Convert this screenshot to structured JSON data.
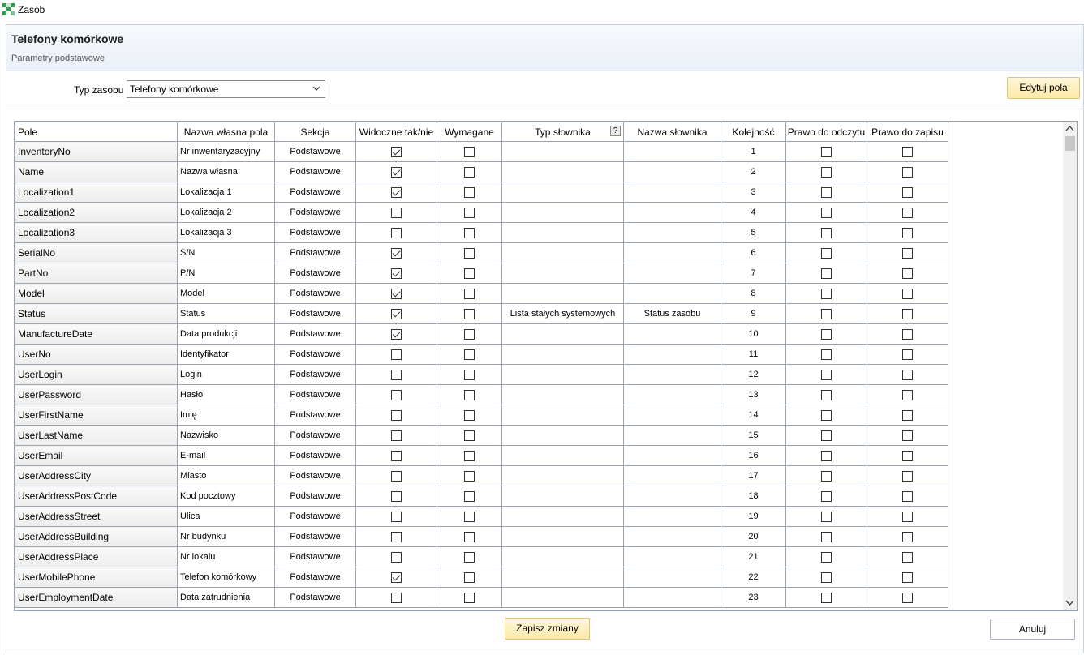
{
  "window": {
    "title": "Zasób",
    "logo_icon": "app-logo-icon"
  },
  "header": {
    "title": "Telefony komórkowe",
    "subtitle": "Parametry podstawowe"
  },
  "toolbar": {
    "type_label": "Typ zasobu",
    "type_value": "Telefony komórkowe",
    "edit_fields_label": "Edytuj pola"
  },
  "grid": {
    "columns": {
      "pole": "Pole",
      "name": "Nazwa własna pola",
      "section": "Sekcja",
      "visible": "Widoczne tak/nie",
      "required": "Wymagane",
      "dict_type": "Typ słownika",
      "dict_help": "?",
      "dict_name": "Nazwa słownika",
      "order": "Kolejność",
      "read": "Prawo do odczytu",
      "write": "Prawo do zapisu"
    },
    "rows": [
      {
        "field": "InventoryNo",
        "name": "Nr inwentaryzacyjny",
        "section": "Podstawowe",
        "visible": true,
        "required": false,
        "dict_type": "",
        "dict_name": "",
        "order": "1",
        "read": false,
        "write": false
      },
      {
        "field": "Name",
        "name": "Nazwa własna",
        "section": "Podstawowe",
        "visible": true,
        "required": false,
        "dict_type": "",
        "dict_name": "",
        "order": "2",
        "read": false,
        "write": false
      },
      {
        "field": "Localization1",
        "name": "Lokalizacja 1",
        "section": "Podstawowe",
        "visible": true,
        "required": false,
        "dict_type": "",
        "dict_name": "",
        "order": "3",
        "read": false,
        "write": false
      },
      {
        "field": "Localization2",
        "name": "Lokalizacja 2",
        "section": "Podstawowe",
        "visible": false,
        "required": false,
        "dict_type": "",
        "dict_name": "",
        "order": "4",
        "read": false,
        "write": false
      },
      {
        "field": "Localization3",
        "name": "Lokalizacja 3",
        "section": "Podstawowe",
        "visible": false,
        "required": false,
        "dict_type": "",
        "dict_name": "",
        "order": "5",
        "read": false,
        "write": false
      },
      {
        "field": "SerialNo",
        "name": "S/N",
        "section": "Podstawowe",
        "visible": true,
        "required": false,
        "dict_type": "",
        "dict_name": "",
        "order": "6",
        "read": false,
        "write": false
      },
      {
        "field": "PartNo",
        "name": "P/N",
        "section": "Podstawowe",
        "visible": true,
        "required": false,
        "dict_type": "",
        "dict_name": "",
        "order": "7",
        "read": false,
        "write": false
      },
      {
        "field": "Model",
        "name": "Model",
        "section": "Podstawowe",
        "visible": true,
        "required": false,
        "dict_type": "",
        "dict_name": "",
        "order": "8",
        "read": false,
        "write": false
      },
      {
        "field": "Status",
        "name": "Status",
        "section": "Podstawowe",
        "visible": true,
        "required": false,
        "dict_type": "Lista stałych systemowych",
        "dict_name": "Status zasobu",
        "order": "9",
        "read": false,
        "write": false
      },
      {
        "field": "ManufactureDate",
        "name": "Data produkcji",
        "section": "Podstawowe",
        "visible": true,
        "required": false,
        "dict_type": "",
        "dict_name": "",
        "order": "10",
        "read": false,
        "write": false
      },
      {
        "field": "UserNo",
        "name": "Identyfikator",
        "section": "Podstawowe",
        "visible": false,
        "required": false,
        "dict_type": "",
        "dict_name": "",
        "order": "11",
        "read": false,
        "write": false
      },
      {
        "field": "UserLogin",
        "name": "Login",
        "section": "Podstawowe",
        "visible": false,
        "required": false,
        "dict_type": "",
        "dict_name": "",
        "order": "12",
        "read": false,
        "write": false
      },
      {
        "field": "UserPassword",
        "name": "Hasło",
        "section": "Podstawowe",
        "visible": false,
        "required": false,
        "dict_type": "",
        "dict_name": "",
        "order": "13",
        "read": false,
        "write": false
      },
      {
        "field": "UserFirstName",
        "name": "Imię",
        "section": "Podstawowe",
        "visible": false,
        "required": false,
        "dict_type": "",
        "dict_name": "",
        "order": "14",
        "read": false,
        "write": false
      },
      {
        "field": "UserLastName",
        "name": "Nazwisko",
        "section": "Podstawowe",
        "visible": false,
        "required": false,
        "dict_type": "",
        "dict_name": "",
        "order": "15",
        "read": false,
        "write": false
      },
      {
        "field": "UserEmail",
        "name": "E-mail",
        "section": "Podstawowe",
        "visible": false,
        "required": false,
        "dict_type": "",
        "dict_name": "",
        "order": "16",
        "read": false,
        "write": false
      },
      {
        "field": "UserAddressCity",
        "name": "Miasto",
        "section": "Podstawowe",
        "visible": false,
        "required": false,
        "dict_type": "",
        "dict_name": "",
        "order": "17",
        "read": false,
        "write": false
      },
      {
        "field": "UserAddressPostCode",
        "name": "Kod pocztowy",
        "section": "Podstawowe",
        "visible": false,
        "required": false,
        "dict_type": "",
        "dict_name": "",
        "order": "18",
        "read": false,
        "write": false
      },
      {
        "field": "UserAddressStreet",
        "name": "Ulica",
        "section": "Podstawowe",
        "visible": false,
        "required": false,
        "dict_type": "",
        "dict_name": "",
        "order": "19",
        "read": false,
        "write": false
      },
      {
        "field": "UserAddressBuilding",
        "name": "Nr budynku",
        "section": "Podstawowe",
        "visible": false,
        "required": false,
        "dict_type": "",
        "dict_name": "",
        "order": "20",
        "read": false,
        "write": false
      },
      {
        "field": "UserAddressPlace",
        "name": "Nr lokalu",
        "section": "Podstawowe",
        "visible": false,
        "required": false,
        "dict_type": "",
        "dict_name": "",
        "order": "21",
        "read": false,
        "write": false
      },
      {
        "field": "UserMobilePhone",
        "name": "Telefon komórkowy",
        "section": "Podstawowe",
        "visible": true,
        "required": false,
        "dict_type": "",
        "dict_name": "",
        "order": "22",
        "read": false,
        "write": false
      },
      {
        "field": "UserEmploymentDate",
        "name": "Data zatrudnienia",
        "section": "Podstawowe",
        "visible": false,
        "required": false,
        "dict_type": "",
        "dict_name": "",
        "order": "23",
        "read": false,
        "write": false
      }
    ]
  },
  "footer": {
    "save_label": "Zapisz zmiany",
    "cancel_label": "Anuluj"
  },
  "colors": {
    "accent_button": "#fde9a8",
    "header_bg": "#eaf0f7",
    "grid_border": "#9aa3ad"
  }
}
